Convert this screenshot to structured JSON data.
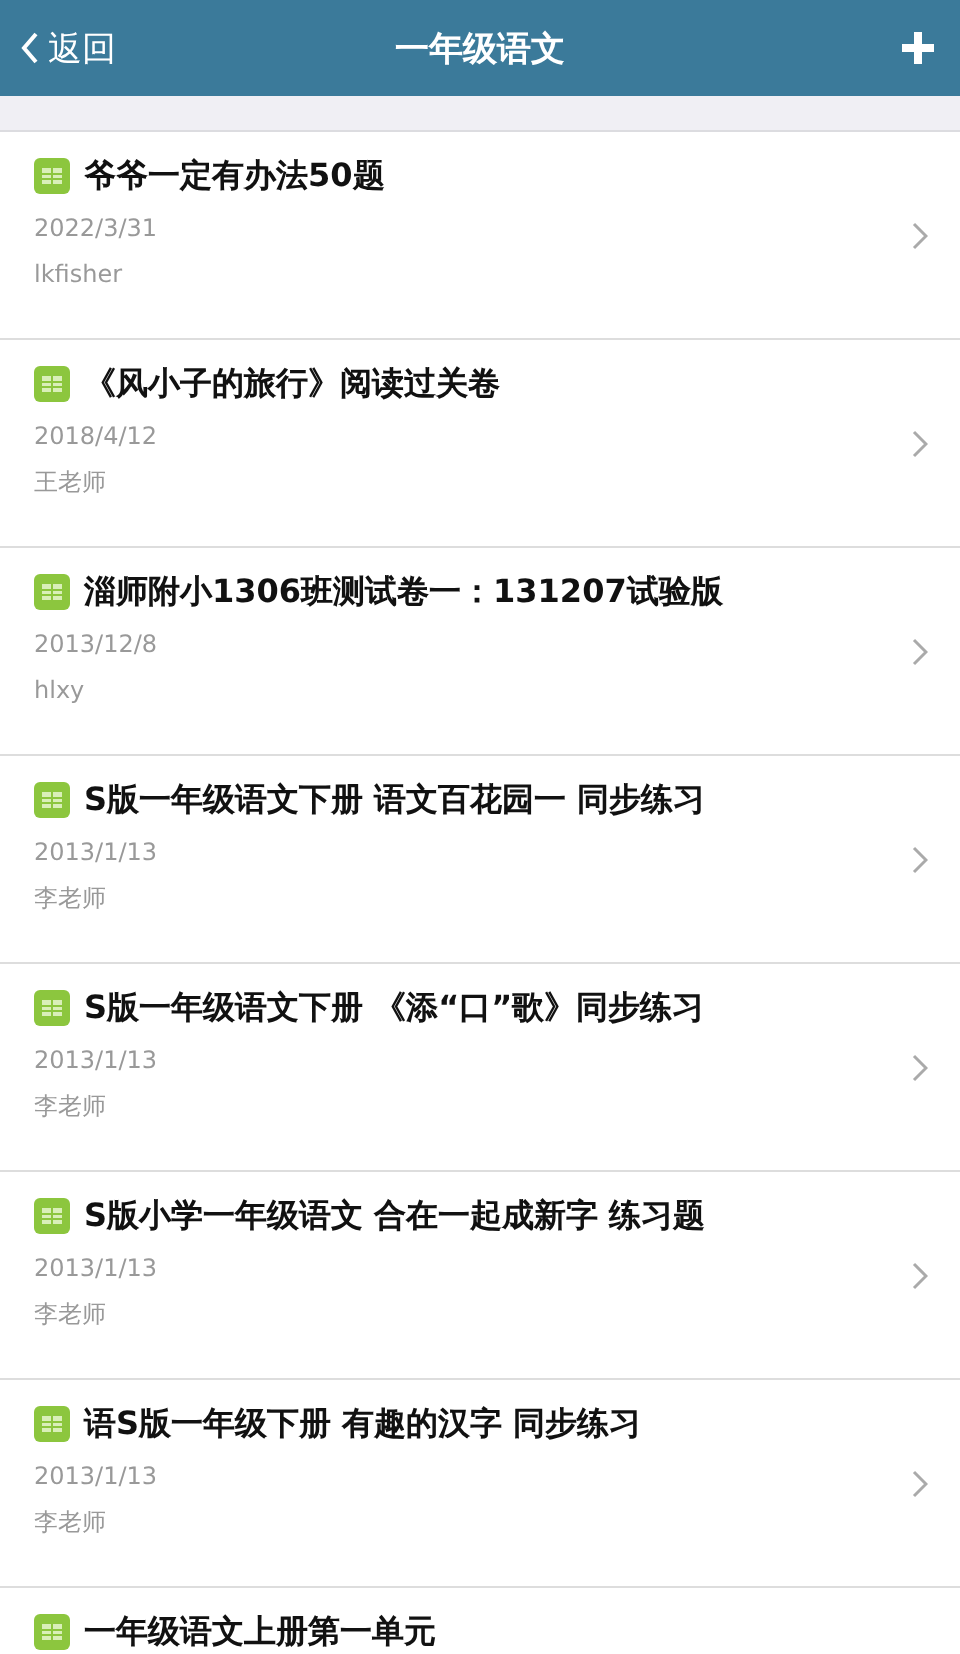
{
  "header": {
    "back": "返回",
    "title": "一年级语文"
  },
  "items": [
    {
      "title": "爷爷一定有办法50题",
      "date": "2022/3/31",
      "author": "lkfisher"
    },
    {
      "title": "《风小子的旅行》阅读过关卷",
      "date": "2018/4/12",
      "author": "王老师"
    },
    {
      "title": "淄师附小1306班测试卷一：131207试验版",
      "date": "2013/12/8",
      "author": "hlxy"
    },
    {
      "title": "S版一年级语文下册 语文百花园一 同步练习",
      "date": "2013/1/13",
      "author": "李老师"
    },
    {
      "title": "S版一年级语文下册 《添“口”歌》同步练习",
      "date": "2013/1/13",
      "author": "李老师"
    },
    {
      "title": "S版小学一年级语文 合在一起成新字 练习题",
      "date": "2013/1/13",
      "author": "李老师"
    },
    {
      "title": "语S版一年级下册 有趣的汉字 同步练习",
      "date": "2013/1/13",
      "author": "李老师"
    },
    {
      "title": "一年级语文上册第一单元"
    }
  ]
}
